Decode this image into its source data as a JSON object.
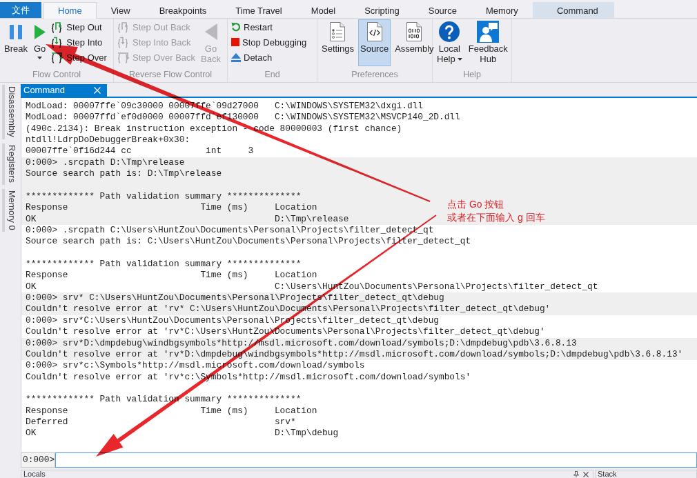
{
  "ribbon_tabs": [
    {
      "label": "文件",
      "kind": "file",
      "selected": false
    },
    {
      "label": "Home",
      "kind": "tab",
      "selected": true
    },
    {
      "label": "View",
      "kind": "tab",
      "selected": false
    },
    {
      "label": "Breakpoints",
      "kind": "tab",
      "selected": false
    },
    {
      "label": "Time Travel",
      "kind": "tab",
      "selected": false
    },
    {
      "label": "Model",
      "kind": "tab",
      "selected": false
    },
    {
      "label": "Scripting",
      "kind": "tab",
      "selected": false
    },
    {
      "label": "Source",
      "kind": "tab",
      "selected": false
    },
    {
      "label": "Memory",
      "kind": "tab",
      "selected": false
    },
    {
      "label": "Command",
      "kind": "contextual",
      "selected": false
    }
  ],
  "ribbon_groups": [
    {
      "label": "Flow Control",
      "items": [
        {
          "label": "Break",
          "kind": "large",
          "disabled": false,
          "dropdown": false
        },
        {
          "label": "Go",
          "kind": "large",
          "disabled": false,
          "dropdown": true
        },
        {
          "label": "Step Out",
          "kind": "small",
          "disabled": false,
          "dropdown": false
        },
        {
          "label": "Step Into",
          "kind": "small",
          "disabled": false,
          "dropdown": false
        },
        {
          "label": "Step Over",
          "kind": "small",
          "disabled": false,
          "dropdown": false
        }
      ]
    },
    {
      "label": "Reverse Flow Control",
      "items": [
        {
          "label": "Step Out Back",
          "kind": "small",
          "disabled": true,
          "dropdown": false
        },
        {
          "label": "Step Into Back",
          "kind": "small",
          "disabled": true,
          "dropdown": false
        },
        {
          "label": "Step Over Back",
          "kind": "small",
          "disabled": true,
          "dropdown": false
        },
        {
          "label": "Go Back",
          "kind": "large",
          "disabled": true,
          "dropdown": false
        }
      ]
    },
    {
      "label": "End",
      "items": [
        {
          "label": "Restart",
          "kind": "small",
          "disabled": false,
          "dropdown": false
        },
        {
          "label": "Stop Debugging",
          "kind": "small",
          "disabled": false,
          "dropdown": false
        },
        {
          "label": "Detach",
          "kind": "small",
          "disabled": false,
          "dropdown": false
        }
      ]
    },
    {
      "label": "Preferences",
      "items": [
        {
          "label": "Settings",
          "kind": "large",
          "disabled": false,
          "dropdown": false,
          "selected": false
        },
        {
          "label": "Source",
          "kind": "large",
          "disabled": false,
          "dropdown": false,
          "selected": true
        },
        {
          "label": "Assembly",
          "kind": "large",
          "disabled": false,
          "dropdown": false,
          "selected": false
        }
      ]
    },
    {
      "label": "Help",
      "items": [
        {
          "label": "Local Help",
          "kind": "large",
          "disabled": false,
          "dropdown": true
        },
        {
          "label": "Feedback Hub",
          "kind": "large",
          "disabled": false,
          "dropdown": false
        }
      ]
    }
  ],
  "side_tabs": [
    {
      "label": "Disassembly"
    },
    {
      "label": "Registers"
    },
    {
      "label": "Memory 0"
    }
  ],
  "command_panel": {
    "title": "Command",
    "output_blocks": [
      {
        "shaded": false,
        "paragraphs": [
          [
            "ModLoad: 00007ffe`09c30000 00007ffe`09d27000   C:\\WINDOWS\\SYSTEM32\\dxgi.dll",
            "ModLoad: 00007ffd`ef0d0000 00007ffd`ef130000   C:\\WINDOWS\\SYSTEM32\\MSVCP140_2D.dll",
            "(490c.2134): Break instruction exception - code 80000003 (first chance)",
            "ntdll!LdrpDoDebuggerBreak+0x30:",
            "00007ffe`0f16d244 cc              int     3"
          ]
        ]
      },
      {
        "shaded": true,
        "paragraphs": [
          [
            "0:000> .srcpath D:\\Tmp\\release",
            "Source search path is: D:\\Tmp\\release"
          ],
          [
            "************* Path validation summary **************",
            "Response                         Time (ms)     Location",
            "OK                                             D:\\Tmp\\release"
          ]
        ]
      },
      {
        "shaded": false,
        "paragraphs": [
          [
            "0:000> .srcpath C:\\Users\\HuntZou\\Documents\\Personal\\Projects\\filter_detect_qt",
            "Source search path is: C:\\Users\\HuntZou\\Documents\\Personal\\Projects\\filter_detect_qt"
          ],
          [
            "************* Path validation summary **************",
            "Response                         Time (ms)     Location",
            "OK                                             C:\\Users\\HuntZou\\Documents\\Personal\\Projects\\filter_detect_qt"
          ]
        ]
      },
      {
        "shaded": true,
        "paragraphs": [
          [
            "0:000> srv* C:\\Users\\HuntZou\\Documents\\Personal\\Projects\\filter_detect_qt\\debug",
            "Couldn't resolve error at 'rv* C:\\Users\\HuntZou\\Documents\\Personal\\Projects\\filter_detect_qt\\debug'"
          ]
        ]
      },
      {
        "shaded": false,
        "paragraphs": [
          [
            "0:000> srv*C:\\Users\\HuntZou\\Documents\\Personal\\Projects\\filter_detect_qt\\debug",
            "Couldn't resolve error at 'rv*C:\\Users\\HuntZou\\Documents\\Personal\\Projects\\filter_detect_qt\\debug'"
          ]
        ]
      },
      {
        "shaded": true,
        "paragraphs": [
          [
            "0:000> srv*D:\\dmpdebug\\windbgsymbols*http://msdl.microsoft.com/download/symbols;D:\\dmpdebug\\pdb\\3.6.8.13",
            "Couldn't resolve error at 'rv*D:\\dmpdebug\\windbgsymbols*http://msdl.microsoft.com/download/symbols;D:\\dmpdebug\\pdb\\3.6.8.13'"
          ]
        ]
      },
      {
        "shaded": false,
        "paragraphs": [
          [
            "0:000> srv*c:\\Symbols*http://msdl.microsoft.com/download/symbols",
            "Couldn't resolve error at 'rv*c:\\Symbols*http://msdl.microsoft.com/download/symbols'"
          ],
          [
            "************* Path validation summary **************",
            "Response                         Time (ms)     Location",
            "Deferred                                       srv*",
            "OK                                             D:\\Tmp\\debug"
          ]
        ]
      }
    ],
    "prompt": "0:000>"
  },
  "bottom_panels": [
    {
      "title": "Locals"
    },
    {
      "title": "Stack"
    }
  ],
  "annotation": {
    "lines": [
      "点击 Go 按钮",
      "或者在下面输入 g 回车"
    ]
  }
}
